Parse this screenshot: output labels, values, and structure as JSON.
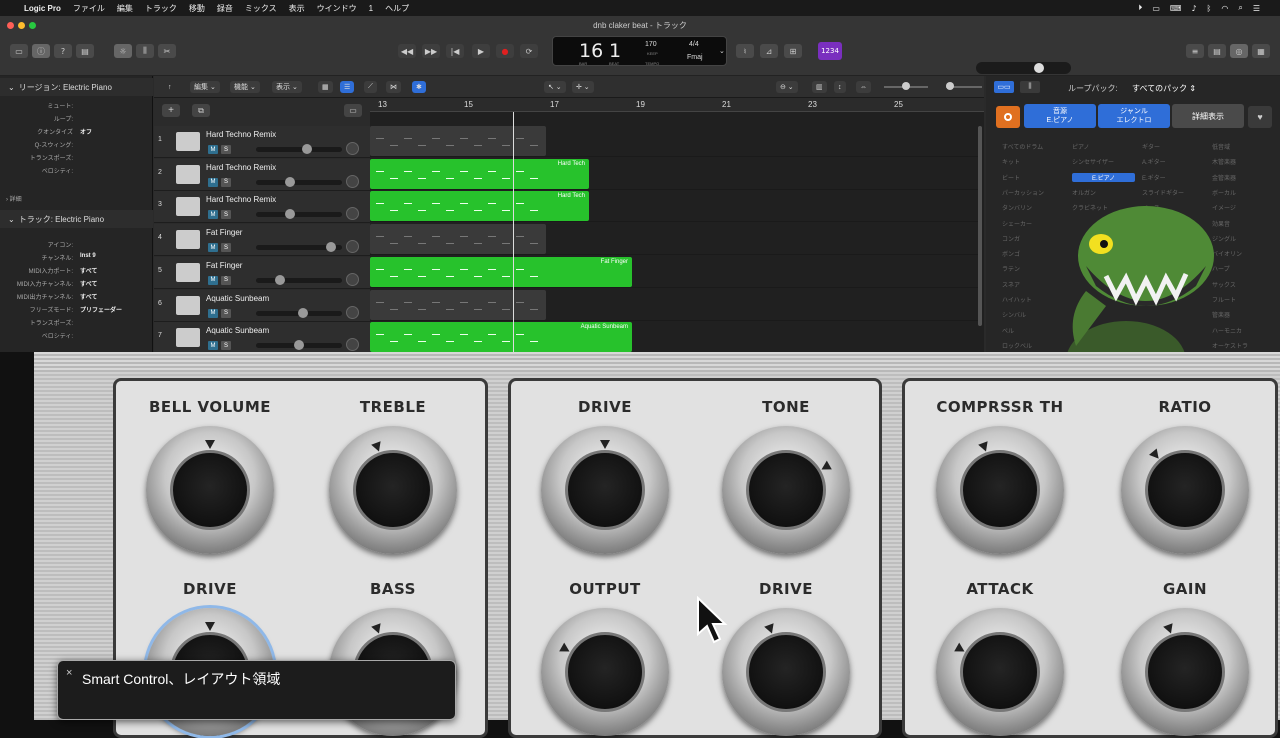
{
  "menubar": {
    "app": "Logic Pro",
    "items": [
      "ファイル",
      "編集",
      "トラック",
      "移動",
      "録音",
      "ミックス",
      "表示",
      "ウインドウ",
      "1",
      "ヘルプ"
    ],
    "datetime": ""
  },
  "window": {
    "title": "dnb claker beat - トラック"
  },
  "lcd": {
    "bar": "16",
    "beat": "1",
    "bar_label": "BAR",
    "beat_label": "BEAT",
    "tempo": "170",
    "tempo_label": "TEMPO",
    "keep": "KEEP",
    "signature": "4/4",
    "key": "Fmaj"
  },
  "toolbar": {
    "count_in": "1234"
  },
  "inspector": {
    "region_header": "リージョン: Electric Piano",
    "region_rows": [
      {
        "label": "ミュート:",
        "value": ""
      },
      {
        "label": "ループ:",
        "value": ""
      },
      {
        "label": "クオンタイズ",
        "value": "オフ"
      },
      {
        "label": "Q-スウィング:",
        "value": ""
      },
      {
        "label": "トランスポーズ:",
        "value": ""
      },
      {
        "label": "ベロシティ:",
        "value": ""
      }
    ],
    "more": "詳細",
    "track_header": "トラック: Electric Piano",
    "track_rows": [
      {
        "label": "アイコン:",
        "value": ""
      },
      {
        "label": "チャンネル:",
        "value": "Inst 9"
      },
      {
        "label": "MIDI入力ポート:",
        "value": "すべて"
      },
      {
        "label": "MIDI入力チャンネル:",
        "value": "すべて"
      },
      {
        "label": "MIDI出力チャンネル:",
        "value": "すべて"
      },
      {
        "label": "フリーズモード:",
        "value": "プリフェーダー"
      },
      {
        "label": "トランスポーズ:",
        "value": ""
      },
      {
        "label": "ベロシティ:",
        "value": ""
      }
    ]
  },
  "tracksbar": {
    "edit": "編集",
    "functions": "機能",
    "view": "表示"
  },
  "ruler": {
    "marks": [
      "13",
      "15",
      "17",
      "19",
      "21",
      "23",
      "25"
    ]
  },
  "tracks": [
    {
      "num": "1",
      "name": "Hard Techno Remix",
      "m": "M",
      "s": "S",
      "volume": 0.6
    },
    {
      "num": "2",
      "name": "Hard Techno Remix",
      "m": "M",
      "s": "S",
      "volume": 0.38
    },
    {
      "num": "3",
      "name": "Hard Techno Remix",
      "m": "M",
      "s": "S",
      "volume": 0.38
    },
    {
      "num": "4",
      "name": "Fat Finger",
      "m": "M",
      "s": "S",
      "volume": 0.92
    },
    {
      "num": "5",
      "name": "Fat Finger",
      "m": "M",
      "s": "S",
      "volume": 0.25
    },
    {
      "num": "6",
      "name": "Aquatic Sunbeam",
      "m": "M",
      "s": "S",
      "volume": 0.55
    },
    {
      "num": "7",
      "name": "Aquatic Sunbeam",
      "m": "M",
      "s": "S",
      "volume": 0.5
    }
  ],
  "regions": [
    {
      "lane": 0,
      "label": "",
      "color": "grey"
    },
    {
      "lane": 1,
      "label": "Hard Tech",
      "color": "green"
    },
    {
      "lane": 2,
      "label": "Hard Tech",
      "color": "green"
    },
    {
      "lane": 3,
      "label": "",
      "color": "grey"
    },
    {
      "lane": 4,
      "label": "Fat Finger",
      "color": "green"
    },
    {
      "lane": 5,
      "label": "",
      "color": "grey"
    },
    {
      "lane": 6,
      "label": "Aquatic Sunbeam",
      "color": "green"
    }
  ],
  "loops": {
    "label": "ループパック:",
    "pack": "すべてのパック",
    "btn1_line1": "音源",
    "btn1_line2": "E.ピアノ",
    "btn2_line1": "ジャンル",
    "btn2_line2": "エレクトロ",
    "details": "詳細表示",
    "keywords": [
      "すべてのドラム",
      "ピアノ",
      "ギター",
      "低音域",
      "キット",
      "シンセサイザー",
      "A.ギター",
      "木管楽器",
      "ビート",
      "E.ピアノ",
      "E.ギター",
      "金管楽器",
      "パーカッション",
      "オルガン",
      "スライドギター",
      "ボーカル",
      "タンバリン",
      "クラビネット",
      "ベース",
      "イメージ",
      "シェーカー",
      "",
      "",
      "効果音",
      "コンガ",
      "",
      "",
      "ジングル",
      "ボンゴ",
      "",
      "",
      "バイオリン",
      "ラテン",
      "",
      "",
      "ハープ",
      "スネア",
      "",
      "",
      "サックス",
      "ハイハット",
      "",
      "",
      "フルート",
      "シンバル",
      "",
      "",
      "管楽器",
      "ベル",
      "",
      "",
      "ハーモニカ",
      "ロックベル",
      "",
      "",
      "オーケストラ"
    ]
  },
  "smart_controls": {
    "knobs": [
      {
        "label": "BELL VOLUME"
      },
      {
        "label": "TREBLE"
      },
      {
        "label": "DRIVE"
      },
      {
        "label": "BASS"
      },
      {
        "label": "DRIVE"
      },
      {
        "label": "TONE"
      },
      {
        "label": "OUTPUT"
      },
      {
        "label": "DRIVE"
      },
      {
        "label": "COMPRSSR TH"
      },
      {
        "label": "RATIO"
      },
      {
        "label": "ATTACK"
      },
      {
        "label": "GAIN"
      }
    ]
  },
  "tooltip": {
    "text": "Smart Control、レイアウト領域",
    "close": "×"
  }
}
